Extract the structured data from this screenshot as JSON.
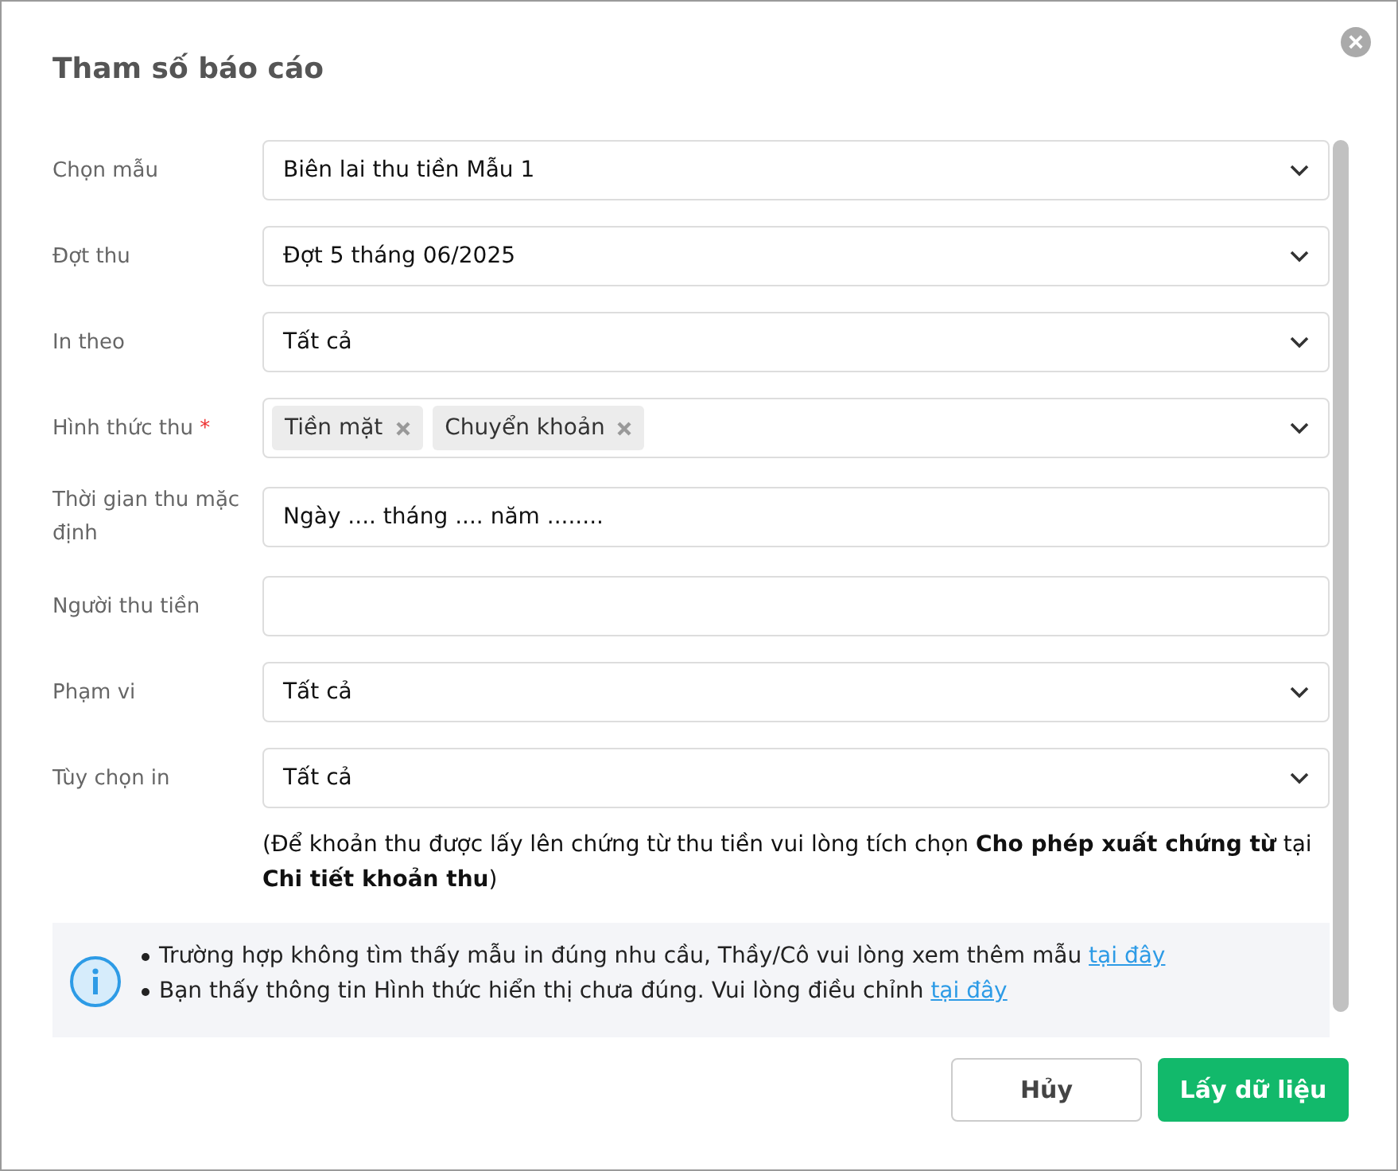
{
  "dialog": {
    "title": "Tham số báo cáo",
    "close_icon": "×"
  },
  "fields": [
    {
      "kind": "select",
      "label": "Chọn mẫu",
      "value": "Biên lai thu tiền Mẫu 1"
    },
    {
      "kind": "select",
      "label": "Đợt thu",
      "value": "Đợt 5 tháng 06/2025"
    },
    {
      "kind": "select",
      "label": "In theo",
      "value": "Tất cả"
    },
    {
      "kind": "tags",
      "label": "Hình thức thu",
      "required_mark": "*",
      "tags": [
        "Tiền mặt",
        "Chuyển khoản"
      ]
    },
    {
      "kind": "text",
      "label": "Thời gian thu mặc định",
      "value": "Ngày .... tháng .... năm ........"
    },
    {
      "kind": "text",
      "label": "Người thu tiền"
    },
    {
      "kind": "select",
      "label": "Phạm vi",
      "value": "Tất cả"
    },
    {
      "kind": "select",
      "label": "Tùy chọn in",
      "value": "Tất cả"
    }
  ],
  "note": "(Để khoản thu được lấy lên chứng từ thu tiền vui lòng tích chọn **Cho phép xuất chứng từ** tại **Chi tiết khoản thu**)",
  "info": [
    {
      "text": "Trường hợp không tìm thấy mẫu in đúng nhu cầu, Thầy/Cô vui lòng xem thêm mẫu",
      "link": "tại đây"
    },
    {
      "text": "Bạn thấy thông tin Hình thức hiển thị chưa đúng. Vui lòng điều chỉnh",
      "link": "tại đây"
    }
  ],
  "buttons": [
    {
      "label": "Hủy",
      "kind": "secondary"
    },
    {
      "label": "Lấy dữ liệu",
      "kind": "primary"
    }
  ]
}
